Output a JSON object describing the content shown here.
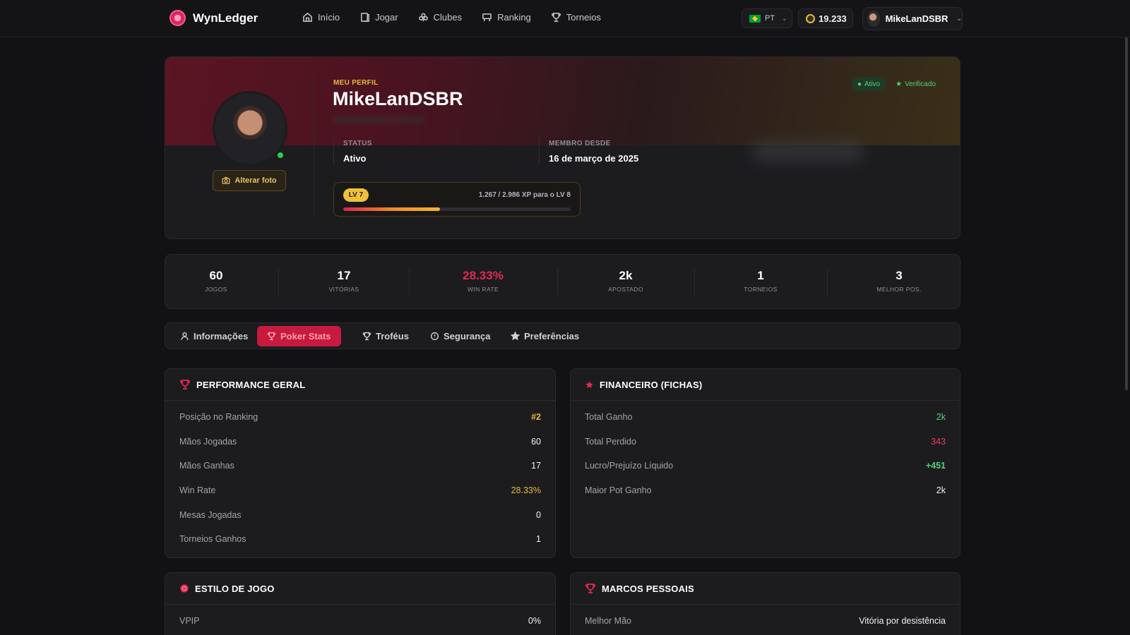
{
  "brand": {
    "name": "WynLedger"
  },
  "nav": [
    {
      "label": "Início",
      "icon": "home-icon"
    },
    {
      "label": "Jogar",
      "icon": "cards-icon"
    },
    {
      "label": "Clubes",
      "icon": "club-icon"
    },
    {
      "label": "Ranking",
      "icon": "podium-icon"
    },
    {
      "label": "Torneios",
      "icon": "trophy-icon"
    }
  ],
  "header": {
    "lang": "PT",
    "chips": "19.233",
    "username": "MikeLanDSBR"
  },
  "profile": {
    "eyebrow": "MEU PERFIL",
    "name": "MikeLanDSBR",
    "change_photo": "Alterar foto",
    "badge_active": "Ativo",
    "badge_verified": "Verificado",
    "status_label": "STATUS",
    "status_value": "Ativo",
    "member_label": "MEMBRO DESDE",
    "member_value": "16 de março de 2025",
    "level": "LV 7",
    "xp_text": "1.267 / 2.986 XP para o LV 8",
    "xp_progress": 0.424
  },
  "stats": [
    {
      "value": "60",
      "label": "JOGOS"
    },
    {
      "value": "17",
      "label": "VITÓRIAS"
    },
    {
      "value": "28.33%",
      "label": "WIN RATE"
    },
    {
      "value": "2k",
      "label": "APOSTADO"
    },
    {
      "value": "1",
      "label": "TORNEIOS"
    },
    {
      "value": "3",
      "label": "MELHOR POS."
    }
  ],
  "tabs": [
    {
      "label": "Informações",
      "icon": "user-icon"
    },
    {
      "label": "Poker Stats",
      "icon": "trophy-icon"
    },
    {
      "label": "Troféus",
      "icon": "trophy-icon"
    },
    {
      "label": "Segurança",
      "icon": "shield-icon"
    },
    {
      "label": "Preferências",
      "icon": "star-icon"
    }
  ],
  "performance": {
    "title": "PERFORMANCE GERAL",
    "rows": [
      {
        "label": "Posição no Ranking",
        "value": "#2"
      },
      {
        "label": "Mãos Jogadas",
        "value": "60"
      },
      {
        "label": "Mãos Ganhas",
        "value": "17"
      },
      {
        "label": "Win Rate",
        "value": "28.33%"
      },
      {
        "label": "Mesas Jogadas",
        "value": "0"
      },
      {
        "label": "Torneios Ganhos",
        "value": "1"
      }
    ]
  },
  "financeiro": {
    "title": "FINANCEIRO (FICHAS)",
    "rows": [
      {
        "label": "Total Ganho",
        "value": "2k"
      },
      {
        "label": "Total Perdido",
        "value": "343"
      },
      {
        "label": "Lucro/Prejuízo Líquido",
        "value": "+451"
      },
      {
        "label": "Maior Pot Ganho",
        "value": "2k"
      }
    ]
  },
  "estilo": {
    "title": "ESTILO DE JOGO",
    "rows": [
      {
        "label": "VPIP",
        "value": "0%"
      }
    ]
  },
  "marcos": {
    "title": "MARCOS PESSOAIS",
    "rows": [
      {
        "label": "Melhor Mão",
        "value": "Vitória por desistência"
      }
    ]
  },
  "colors": {
    "accent_red": "#c8193f",
    "gold": "#e7b93a",
    "green": "#4ed27a",
    "loss_red": "#ef3b57"
  }
}
